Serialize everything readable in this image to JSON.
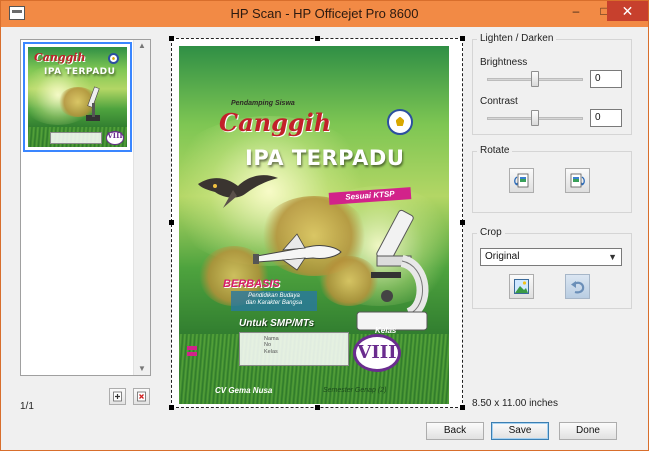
{
  "window": {
    "title": "HP Scan - HP Officejet Pro 8600",
    "minimize_label": "–",
    "maximize_label": "□",
    "close_label": "✕"
  },
  "thumbnails": {
    "page_count": "1/1"
  },
  "cover": {
    "pendamping": "Pendamping Siswa",
    "canggih": "Canggih",
    "title": "IPA TERPADU",
    "ktsp": "Sesuai KTSP",
    "berbasis": "BERBASIS",
    "berbasis_line1": "Pendidikan Budaya",
    "berbasis_line2": "dan Karakter Bangsa",
    "untuk": "Untuk SMP/MTs",
    "field_nama": "Nama",
    "field_no": "No",
    "field_kelas": "Kelas",
    "kelas_label": "Kelas",
    "grade": "VIII",
    "publisher": "CV Gema Nusa",
    "semester": "Semester Genap (2)"
  },
  "lighten_darken": {
    "title": "Lighten / Darken",
    "brightness_label": "Brightness",
    "brightness_value": "0",
    "brightness_level": 0.5,
    "contrast_label": "Contrast",
    "contrast_value": "0",
    "contrast_level": 0.5
  },
  "rotate": {
    "title": "Rotate",
    "rotate_left_icon": "rotate-left-icon",
    "rotate_right_icon": "rotate-right-icon"
  },
  "crop": {
    "title": "Crop",
    "selected_option": "Original",
    "crop_icon": "image-crop-icon",
    "undo_icon": "undo-icon"
  },
  "page_size": "8.50 x 11.00 inches",
  "footer": {
    "back_label": "Back",
    "save_label": "Save",
    "done_label": "Done"
  },
  "colors": {
    "titlebar": "#f28a45",
    "close": "#c7402d",
    "canggih": "#c2202a",
    "ktsp": "#d2238a",
    "grade": "#6a2c8e"
  }
}
